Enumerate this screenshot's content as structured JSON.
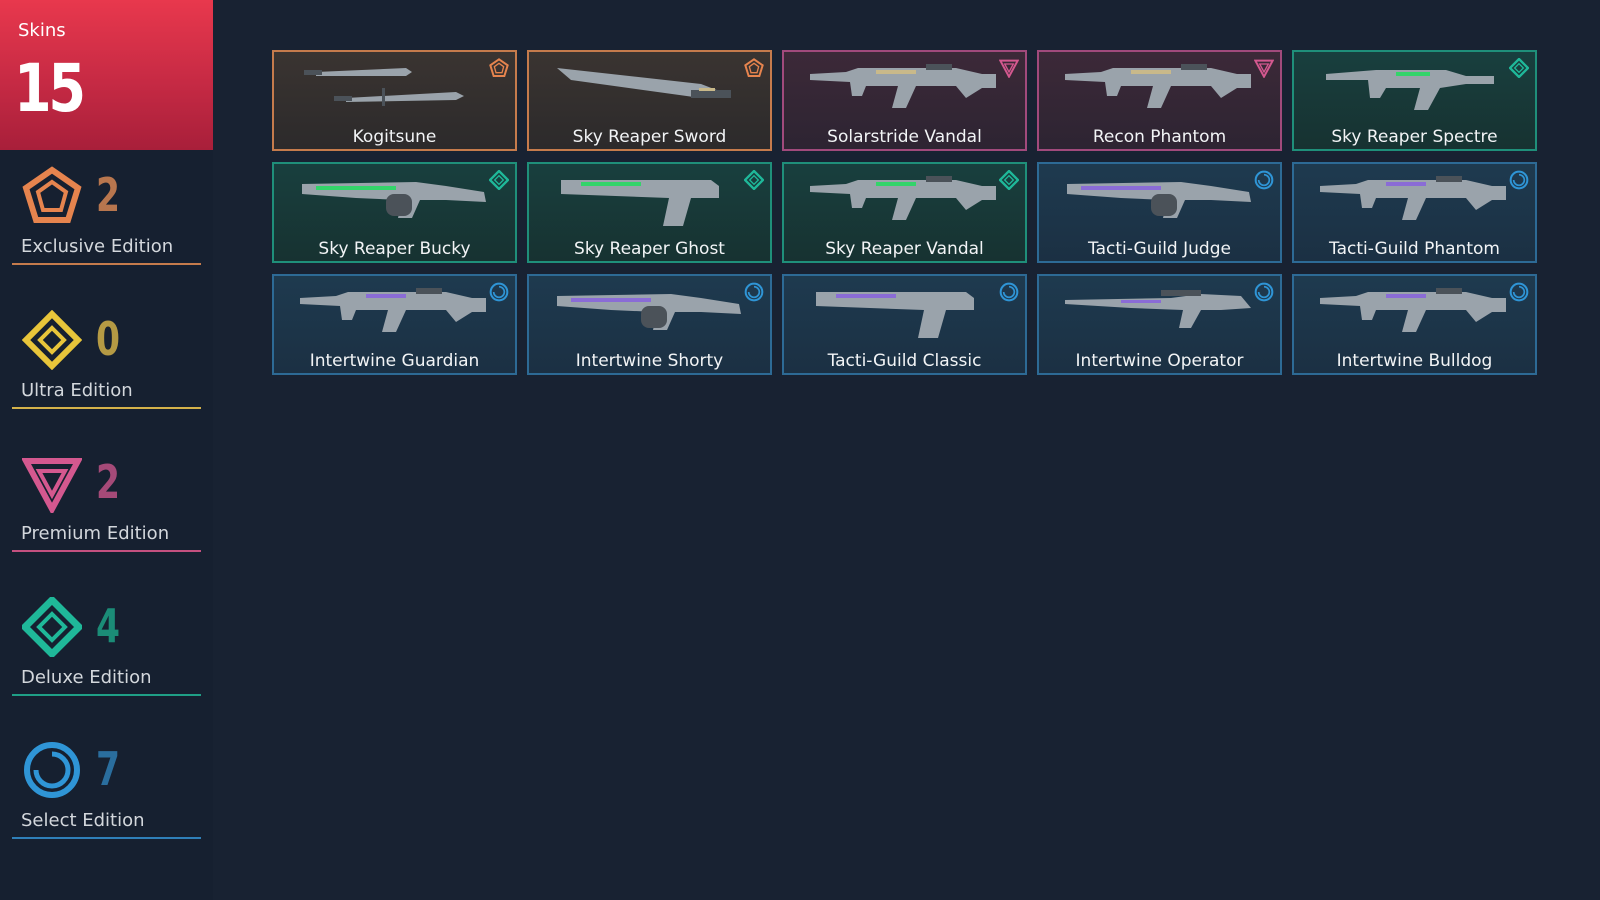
{
  "summary": {
    "title": "Skins",
    "total": "15"
  },
  "tiers": [
    {
      "key": "exclusive",
      "label": "Exclusive Edition",
      "count": "2",
      "color": "#e6844e",
      "count_color": "#b8764e",
      "line_color": "#c57b4c",
      "icon": "exclusive-pentagon-icon"
    },
    {
      "key": "ultra",
      "label": "Ultra Edition",
      "count": "0",
      "color": "#e8c53a",
      "count_color": "#b59a44",
      "line_color": "#d4b24a",
      "icon": "ultra-diamond-icon"
    },
    {
      "key": "premium",
      "label": "Premium Edition",
      "count": "2",
      "color": "#d4588f",
      "count_color": "#a54a78",
      "line_color": "#c4507f",
      "icon": "premium-triangle-icon"
    },
    {
      "key": "deluxe",
      "label": "Deluxe Edition",
      "count": "4",
      "color": "#1fb899",
      "count_color": "#1b8c77",
      "line_color": "#1f9f86",
      "icon": "deluxe-diamond-icon"
    },
    {
      "key": "select",
      "label": "Select Edition",
      "count": "7",
      "color": "#2f95d6",
      "count_color": "#2a6e9e",
      "line_color": "#2f7fb8",
      "icon": "select-circle-icon"
    }
  ],
  "skins": [
    {
      "name": "Kogitsune",
      "tier": "exclusive",
      "weapon": "knife"
    },
    {
      "name": "Sky Reaper Sword",
      "tier": "exclusive",
      "weapon": "sword"
    },
    {
      "name": "Solarstride Vandal",
      "tier": "premium",
      "weapon": "rifle"
    },
    {
      "name": "Recon Phantom",
      "tier": "premium",
      "weapon": "rifle"
    },
    {
      "name": "Sky Reaper Spectre",
      "tier": "deluxe",
      "weapon": "smg"
    },
    {
      "name": "Sky Reaper Bucky",
      "tier": "deluxe",
      "weapon": "shotgun"
    },
    {
      "name": "Sky Reaper Ghost",
      "tier": "deluxe",
      "weapon": "pistol"
    },
    {
      "name": "Sky Reaper Vandal",
      "tier": "deluxe",
      "weapon": "rifle"
    },
    {
      "name": "Tacti-Guild Judge",
      "tier": "select",
      "weapon": "shotgun"
    },
    {
      "name": "Tacti-Guild Phantom",
      "tier": "select",
      "weapon": "rifle"
    },
    {
      "name": "Intertwine Guardian",
      "tier": "select",
      "weapon": "rifle"
    },
    {
      "name": "Intertwine Shorty",
      "tier": "select",
      "weapon": "shotgun"
    },
    {
      "name": "Tacti-Guild Classic",
      "tier": "select",
      "weapon": "pistol"
    },
    {
      "name": "Intertwine Operator",
      "tier": "select",
      "weapon": "sniper"
    },
    {
      "name": "Intertwine Bulldog",
      "tier": "select",
      "weapon": "rifle"
    }
  ]
}
